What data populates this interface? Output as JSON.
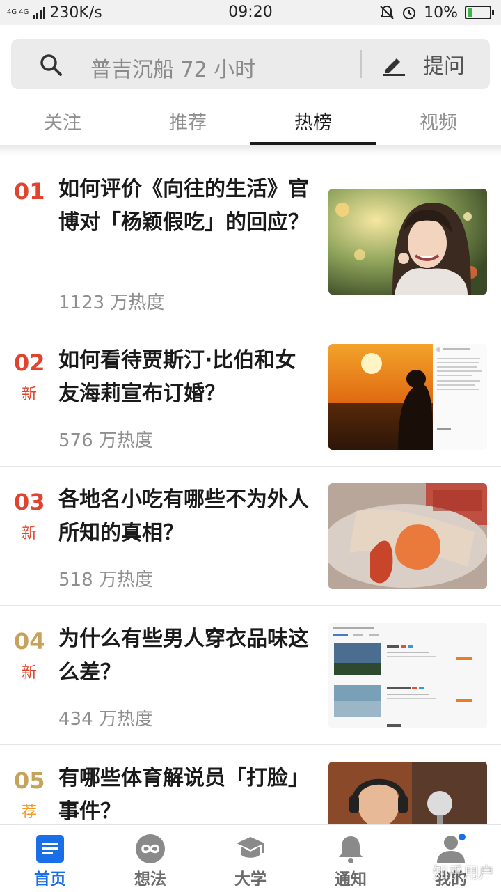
{
  "status_bar": {
    "network": "4G 4G",
    "speed": "230K/s",
    "time": "09:20",
    "battery": "10%",
    "icons": [
      "signal-icon",
      "mute-icon",
      "alarm-icon",
      "battery-icon"
    ]
  },
  "search": {
    "placeholder": "普吉沉船 72 小时",
    "ask_label": "提问"
  },
  "tabs": [
    {
      "label": "关注",
      "active": false
    },
    {
      "label": "推荐",
      "active": false
    },
    {
      "label": "热榜",
      "active": true
    },
    {
      "label": "视频",
      "active": false
    }
  ],
  "hot_list": [
    {
      "rank": "01",
      "tag": "",
      "title": "如何评价《向往的生活》官博对「杨颖假吃」的回应？",
      "heat": "1123 万热度",
      "rank_color": "#e0442f"
    },
    {
      "rank": "02",
      "tag": "新",
      "title": "如何看待贾斯汀·比伯和女友海莉宣布订婚？",
      "heat": "576 万热度",
      "rank_color": "#e0442f"
    },
    {
      "rank": "03",
      "tag": "新",
      "title": "各地名小吃有哪些不为外人所知的真相？",
      "heat": "518 万热度",
      "rank_color": "#e0442f"
    },
    {
      "rank": "04",
      "tag": "新",
      "title": "为什么有些男人穿衣品味这么差？",
      "heat": "434 万热度",
      "rank_color": "#c6a35a"
    },
    {
      "rank": "05",
      "tag": "荐",
      "title": "有哪些体育解说员「打脸」事件？",
      "heat": "",
      "rank_color": "#c6a35a"
    }
  ],
  "bottom_nav": [
    {
      "label": "首页",
      "icon": "home-icon",
      "active": true
    },
    {
      "label": "想法",
      "icon": "idea-icon",
      "active": false
    },
    {
      "label": "大学",
      "icon": "university-icon",
      "active": false
    },
    {
      "label": "通知",
      "icon": "bell-icon",
      "active": false
    },
    {
      "label": "我的",
      "icon": "profile-icon",
      "active": false
    }
  ],
  "watermark": "知乎用户",
  "colors": {
    "accent": "#1a6fe8",
    "rank_hot": "#e0442f",
    "rank_warm": "#c6a35a",
    "tag_new": "#e0442f",
    "tag_rec": "#f39a22"
  }
}
